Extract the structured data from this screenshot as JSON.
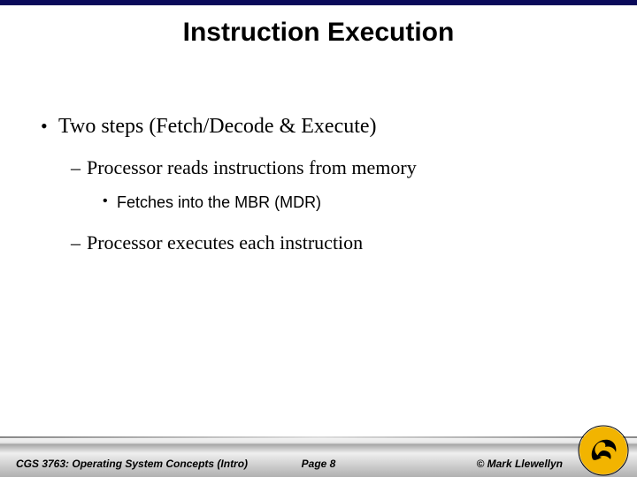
{
  "title": "Instruction Execution",
  "bullets": {
    "b1": "Two steps (Fetch/Decode & Execute)",
    "b1a": "Processor reads instructions from memory",
    "b1a1": "Fetches into the MBR (MDR)",
    "b1b": "Processor executes each instruction"
  },
  "footer": {
    "left": "CGS 3763: Operating System Concepts (Intro)",
    "center": "Page 8",
    "right": "© Mark Llewellyn"
  },
  "logo": {
    "primary": "#f2b400",
    "secondary": "#000000"
  }
}
